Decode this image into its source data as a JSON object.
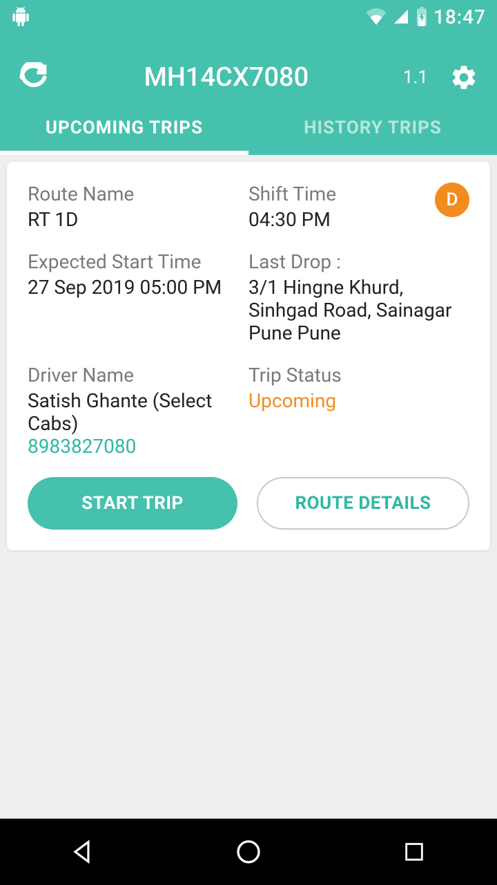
{
  "status": {
    "time": "18:47"
  },
  "header": {
    "title": "MH14CX7080",
    "version": "1.1"
  },
  "tabs": {
    "upcoming": "UPCOMING TRIPS",
    "history": "HISTORY TRIPS"
  },
  "trip": {
    "route_name_label": "Route Name",
    "route_name": "RT 1D",
    "shift_time_label": "Shift Time",
    "shift_time": "04:30 PM",
    "badge": "D",
    "expected_start_label": "Expected Start Time",
    "expected_start": "27 Sep 2019 05:00 PM",
    "last_drop_label": "Last Drop :",
    "last_drop": "3/1 Hingne Khurd, Sinhgad Road, Sainagar Pune Pune",
    "driver_name_label": "Driver Name",
    "driver_name": "Satish Ghante (Select Cabs)",
    "driver_phone": "8983827080",
    "trip_status_label": "Trip Status",
    "trip_status": "Upcoming",
    "start_trip_btn": "START TRIP",
    "route_details_btn": "ROUTE DETAILS"
  }
}
